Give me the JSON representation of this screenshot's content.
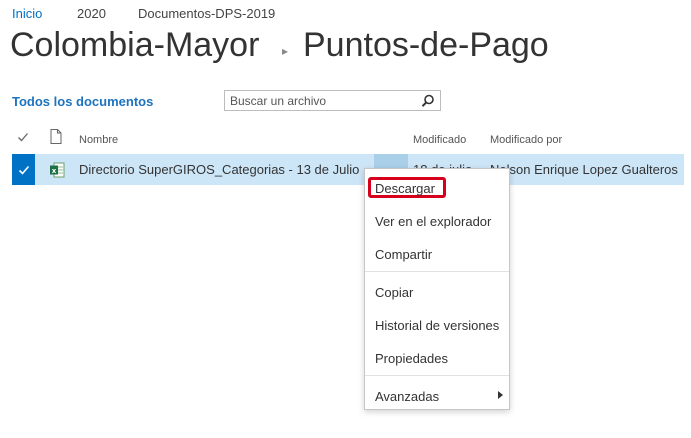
{
  "breadcrumb": [
    "Inicio",
    "2020",
    "Documentos-DPS-2019"
  ],
  "title": {
    "site": "Colombia-Mayor",
    "library": "Puntos-de-Pago"
  },
  "view": {
    "label": "Todos los documentos"
  },
  "search": {
    "placeholder": "Buscar un archivo"
  },
  "columns": {
    "name": "Nombre",
    "modified": "Modificado",
    "modified_by": "Modificado por"
  },
  "row": {
    "name": "Directorio SuperGIROS_Categorias - 13 de Julio",
    "modified": "18 de julio",
    "modified_by": "Nelson Enrique Lopez Gualteros"
  },
  "menu": {
    "download": "Descargar",
    "explorer": "Ver en el explorador",
    "share": "Compartir",
    "copy": "Copiar",
    "history": "Historial de versiones",
    "properties": "Propiedades",
    "advanced": "Avanzadas"
  },
  "colors": {
    "accent": "#0072c6",
    "selected_row": "#cde6f7",
    "highlight": "#d6001c"
  }
}
